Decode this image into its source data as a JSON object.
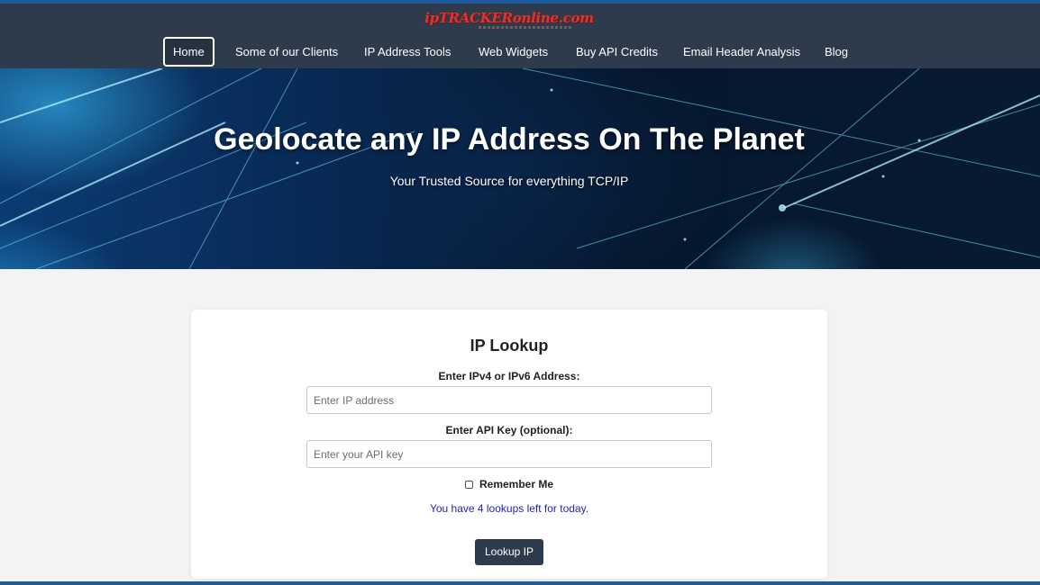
{
  "header": {
    "logo_text": "ipTRACKERonline.com",
    "nav": [
      {
        "label": "Home",
        "active": true
      },
      {
        "label": "Some of our Clients",
        "active": false
      },
      {
        "label": "IP Address Tools",
        "active": false
      },
      {
        "label": "Web Widgets",
        "active": false
      },
      {
        "label": "Buy API Credits",
        "active": false
      },
      {
        "label": "Email Header Analysis",
        "active": false
      },
      {
        "label": "Blog",
        "active": false
      }
    ]
  },
  "hero": {
    "title": "Geolocate any IP Address On The Planet",
    "subtitle": "Your Trusted Source for everything TCP/IP"
  },
  "lookup": {
    "title": "IP Lookup",
    "ip_label": "Enter IPv4 or IPv6 Address:",
    "ip_placeholder": "Enter IP address",
    "ip_value": "",
    "key_label": "Enter API Key (optional):",
    "key_placeholder": "Enter your API key",
    "key_value": "",
    "remember_label": "Remember Me",
    "remember_checked": false,
    "lookups_message": "You have 4 lookups left for today.",
    "button_label": "Lookup IP"
  },
  "colors": {
    "header_bg": "#2e3b4c",
    "logo": "#e0342f",
    "lookups_text": "#2323b8",
    "button_bg": "#2e3b4c",
    "page_bg": "#f3f3f3"
  }
}
